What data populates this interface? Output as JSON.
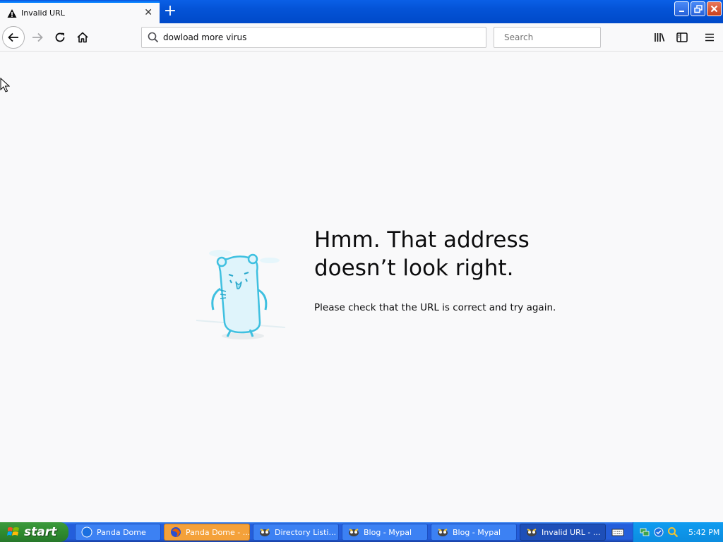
{
  "tab": {
    "title": "Invalid URL",
    "icon": "warning-icon"
  },
  "navbar": {
    "url_value": "dowload more virus",
    "search_placeholder": "Search"
  },
  "content": {
    "title_line1": "Hmm. That address",
    "title_line2": "doesn’t look right.",
    "description": "Please check that the URL is correct and try again."
  },
  "taskbar": {
    "start_label": "start",
    "tasks": [
      {
        "label": "Panda Dome"
      },
      {
        "label": "Panda Dome - ..."
      },
      {
        "label": "Directory Listi..."
      },
      {
        "label": "Blog - Mypal"
      },
      {
        "label": "Blog - Mypal"
      },
      {
        "label": "Invalid URL - ..."
      }
    ],
    "clock": "5:42 PM"
  },
  "colors": {
    "accent": "#0a84ff",
    "taskbar": "#245edb",
    "start": "#2f8b2f"
  }
}
